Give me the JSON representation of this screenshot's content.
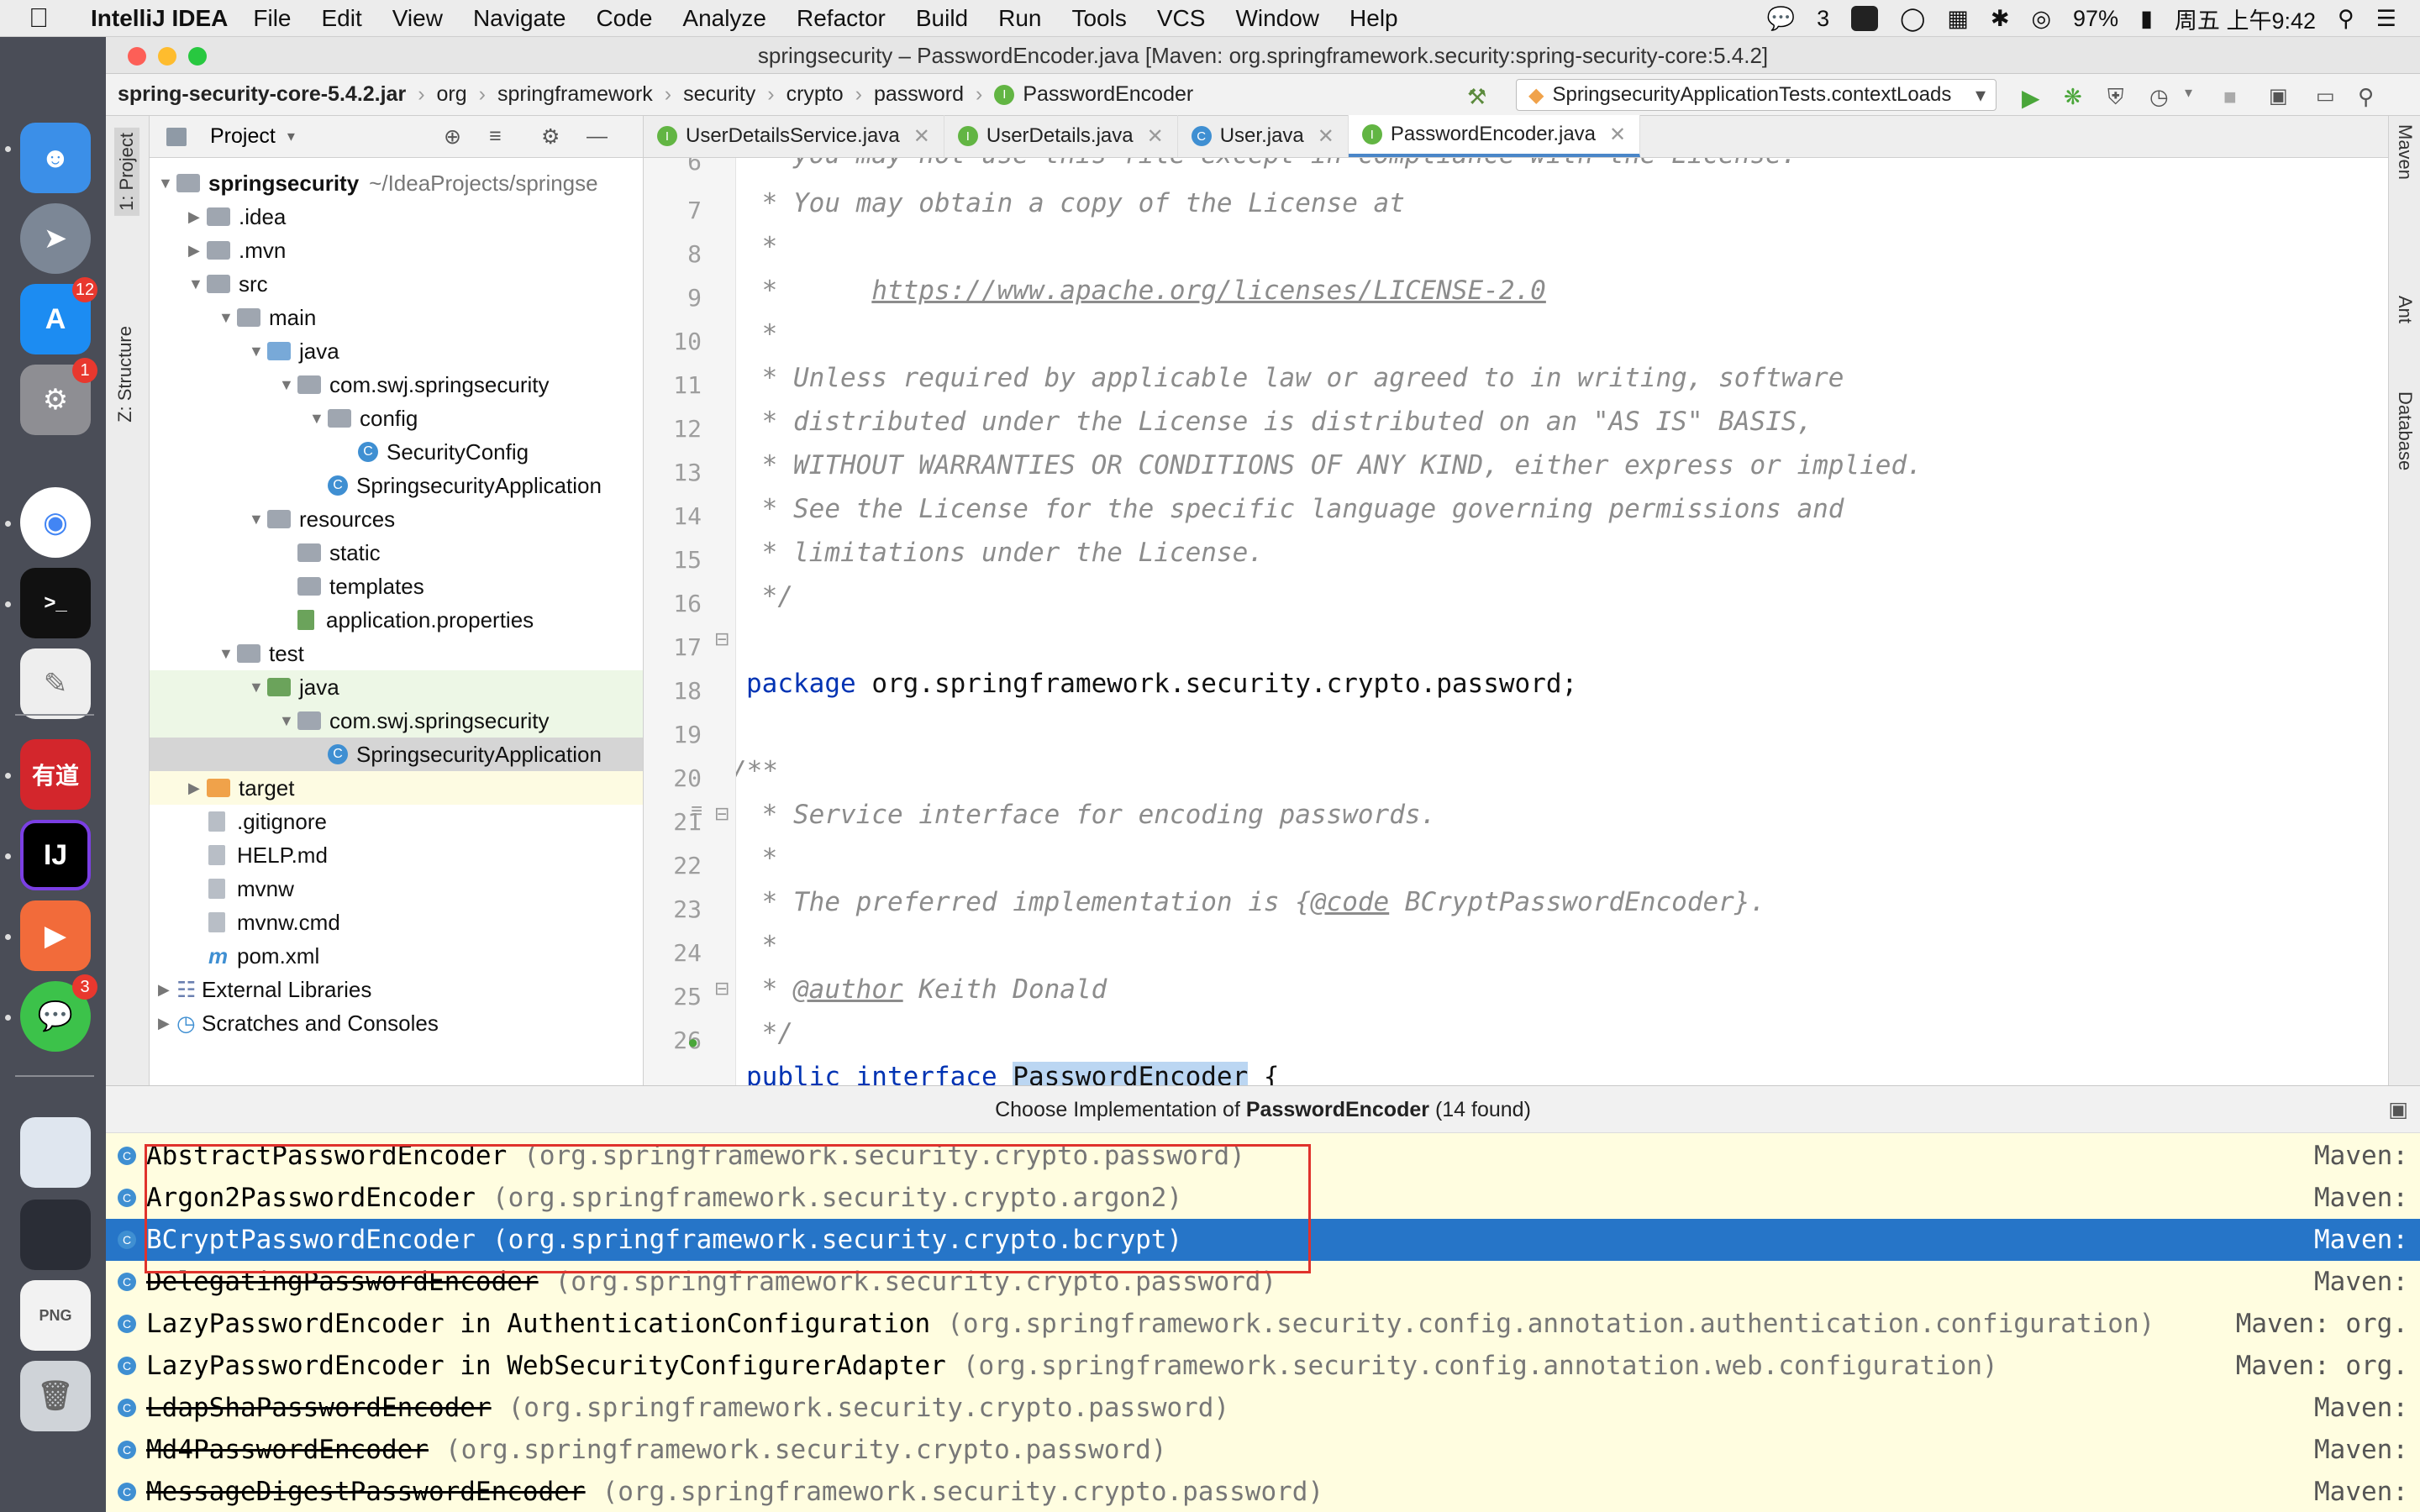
{
  "menubar": {
    "app_name": "IntelliJ IDEA",
    "menus": [
      "File",
      "Edit",
      "View",
      "Navigate",
      "Code",
      "Analyze",
      "Refactor",
      "Build",
      "Run",
      "Tools",
      "VCS",
      "Window",
      "Help"
    ],
    "wechat_count": "3",
    "battery": "97%",
    "clock": "周五 上午9:42"
  },
  "dock": {
    "badges": {
      "appstore": "12",
      "settings": "1",
      "wechat": "3"
    },
    "youdao_label": "有道",
    "ij_label": "IJ",
    "png_label": "PNG"
  },
  "window": {
    "title": "springsecurity – PasswordEncoder.java [Maven: org.springframework.security:spring-security-core:5.4.2]"
  },
  "breadcrumb": {
    "jar": "spring-security-core-5.4.2.jar",
    "parts": [
      "org",
      "springframework",
      "security",
      "crypto",
      "password"
    ],
    "class": "PasswordEncoder"
  },
  "run_config": "SpringsecurityApplicationTests.contextLoads",
  "sidebar": {
    "project_tab": "1: Project",
    "structure_tab": "Z: Structure",
    "project_label": "Project"
  },
  "tree": {
    "root": "springsecurity",
    "root_path": "~/IdeaProjects/springse",
    "items": [
      "idea",
      ".mvn",
      "src",
      "main",
      "java",
      "com.swj.springsecurity",
      "config",
      "SecurityConfig",
      "SpringsecurityApplication",
      "resources",
      "static",
      "templates",
      "application.properties",
      "test",
      "java",
      "com.swj.springsecurity",
      "SpringsecurityApplication",
      "target",
      ".gitignore",
      "HELP.md",
      "mvnw",
      "mvnw.cmd",
      "pom.xml",
      "External Libraries",
      "Scratches and Consoles"
    ]
  },
  "tabs": [
    {
      "label": "UserDetailsService.java",
      "kind": "i"
    },
    {
      "label": "UserDetails.java",
      "kind": "i"
    },
    {
      "label": "User.java",
      "kind": "c"
    },
    {
      "label": "PasswordEncoder.java",
      "kind": "i"
    }
  ],
  "right_tools": [
    "Maven",
    "Ant",
    "Database"
  ],
  "code": {
    "line_numbers": [
      "6",
      "7",
      "8",
      "9",
      "10",
      "11",
      "12",
      "13",
      "14",
      "15",
      "16",
      "17",
      "18",
      "19",
      "20",
      "21",
      "22",
      "23",
      "24",
      "25",
      "26"
    ],
    "partial_top": " * you may not use this file except in compliance with the License.",
    "lines": {
      "l6": " * You may obtain a copy of the License at",
      "l7": " *",
      "l8_prefix": " *      ",
      "l8_url": "https://www.apache.org/licenses/LICENSE-2.0",
      "l9": " *",
      "l10": " * Unless required by applicable law or agreed to in writing, software",
      "l11": " * distributed under the License is distributed on an \"AS IS\" BASIS,",
      "l12": " * WITHOUT WARRANTIES OR CONDITIONS OF ANY KIND, either express or implied.",
      "l13": " * See the License for the specific language governing permissions and",
      "l14": " * limitations under the License.",
      "l15": " */",
      "l17_kw": "package",
      "l17_rest": " org.springframework.security.crypto.password;",
      "l19": "/**",
      "l20": " * Service interface for encoding passwords.",
      "l21": " *",
      "l22_a": " * The preferred implementation is {",
      "l22_tag": "@code",
      "l22_b": " BCryptPasswordEncoder}.",
      "l23": " *",
      "l24_a": " * ",
      "l24_tag": "@author",
      "l24_b": " Keith Donald",
      "l25": " */",
      "l26_kw": "public interface ",
      "l26_name": "PasswordEncoder",
      "l26_rest": " {"
    }
  },
  "popup": {
    "title_prefix": "Choose Implementation of ",
    "title_class": "PasswordEncoder",
    "title_suffix": " (14 found)",
    "rows": [
      {
        "name": "AbstractPasswordEncoder",
        "pkg": "(org.springframework.security.crypto.password)",
        "maven": "Maven:"
      },
      {
        "name": "Argon2PasswordEncoder",
        "pkg": "(org.springframework.security.crypto.argon2)",
        "maven": "Maven:"
      },
      {
        "name": "BCryptPasswordEncoder",
        "pkg": "(org.springframework.security.crypto.bcrypt)",
        "maven": "Maven:"
      },
      {
        "name": "DelegatingPasswordEncoder",
        "pkg": "(org.springframework.security.crypto.password)",
        "maven": "Maven:"
      },
      {
        "name": "LazyPasswordEncoder in AuthenticationConfiguration",
        "pkg": "(org.springframework.security.config.annotation.authentication.configuration)",
        "maven": "Maven: org."
      },
      {
        "name": "LazyPasswordEncoder in WebSecurityConfigurerAdapter",
        "pkg": "(org.springframework.security.config.annotation.web.configuration)",
        "maven": "Maven: org."
      },
      {
        "name": "LdapShaPasswordEncoder",
        "pkg": "(org.springframework.security.crypto.password)",
        "maven": "Maven:"
      },
      {
        "name": "Md4PasswordEncoder",
        "pkg": "(org.springframework.security.crypto.password)",
        "maven": "Maven:"
      },
      {
        "name": "MessageDigestPasswordEncoder",
        "pkg": "(org.springframework.security.crypto.password)",
        "maven": "Maven:"
      }
    ]
  },
  "colors": {
    "selection": "#2675c8",
    "annotation_box": "#e0322c"
  }
}
